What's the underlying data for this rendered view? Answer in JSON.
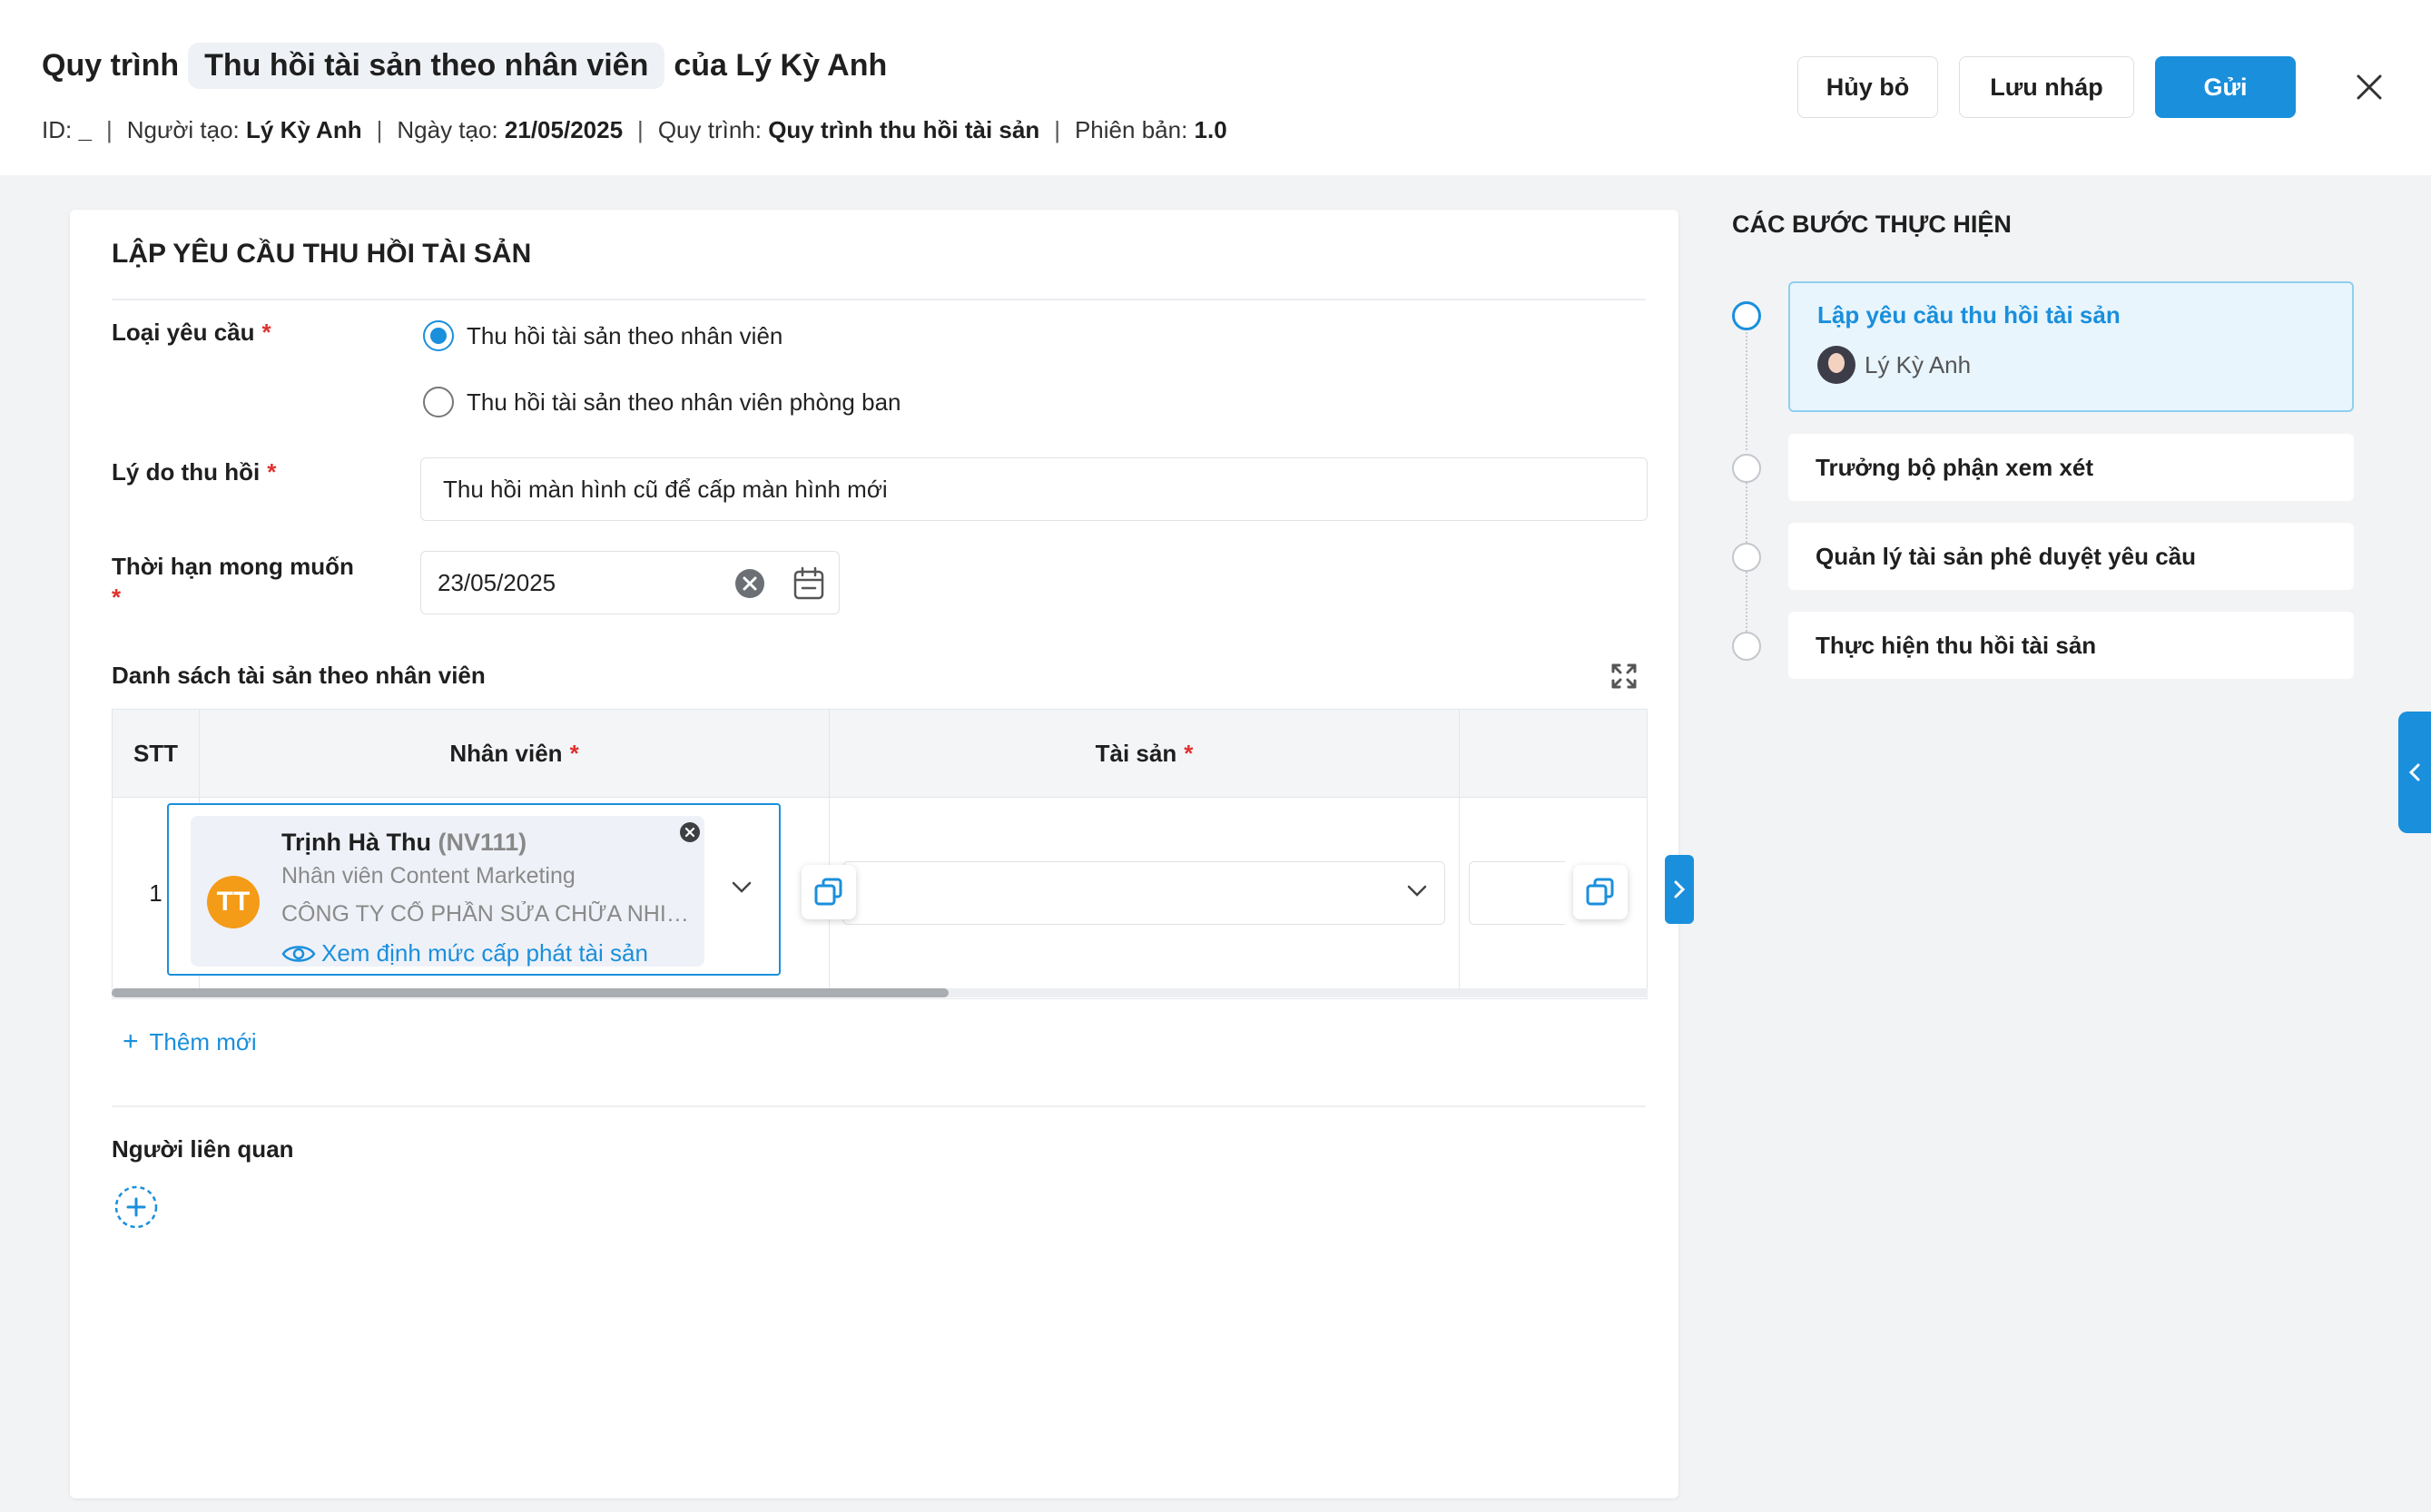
{
  "header": {
    "title_prefix": "Quy trình",
    "title_chip": "Thu hồi tài sản theo nhân viên",
    "title_suffix": "của Lý Kỳ Anh",
    "meta": {
      "id_label": "ID:",
      "id_value": "_",
      "creator_label": "Người tạo:",
      "creator_value": "Lý Kỳ Anh",
      "date_label": "Ngày tạo:",
      "date_value": "21/05/2025",
      "process_label": "Quy trình:",
      "process_value": "Quy trình thu hồi tài sản",
      "version_label": "Phiên bản:",
      "version_value": "1.0",
      "separator": "|"
    },
    "buttons": {
      "cancel": "Hủy bỏ",
      "draft": "Lưu nháp",
      "send": "Gửi"
    }
  },
  "form": {
    "title": "LẬP YÊU CẦU THU HỒI TÀI SẢN",
    "required_mark": "*",
    "request_type": {
      "label": "Loại yêu cầu",
      "options": [
        "Thu hồi tài sản theo nhân viên",
        "Thu hồi tài sản theo nhân viên phòng ban"
      ],
      "selected_index": 0
    },
    "reason": {
      "label": "Lý do thu hồi",
      "value": "Thu hồi màn hình cũ để cấp màn hình mới"
    },
    "deadline": {
      "label": "Thời hạn mong muốn",
      "value": "23/05/2025"
    },
    "asset_list": {
      "title": "Danh sách tài sản theo nhân viên",
      "columns": [
        "STT",
        "Nhân viên",
        "Tài sản"
      ],
      "rows": [
        {
          "stt": "1",
          "employee": {
            "initials": "TT",
            "name": "Trịnh Hà Thu",
            "code": "(NV111)",
            "role": "Nhân viên Content Marketing",
            "company": "CÔNG TY CỔ PHẦN SỬA CHỮA NHIỆT...",
            "link": "Xem định mức cấp phát tài sản"
          }
        }
      ],
      "add_label": "Thêm mới"
    },
    "related": {
      "title": "Người liên quan"
    }
  },
  "steps": {
    "title": "CÁC BƯỚC THỰC HIỆN",
    "items": [
      {
        "label": "Lập yêu cầu thu hồi tài sản",
        "user": "Lý Kỳ Anh",
        "active": true
      },
      {
        "label": "Trưởng bộ phận xem xét"
      },
      {
        "label": "Quản lý tài sản phê duyệt yêu cầu"
      },
      {
        "label": "Thực hiện thu hồi tài sản"
      }
    ]
  },
  "colors": {
    "primary": "#1a8fdc",
    "required": "#e0312f",
    "avatar": "#f49b17"
  }
}
